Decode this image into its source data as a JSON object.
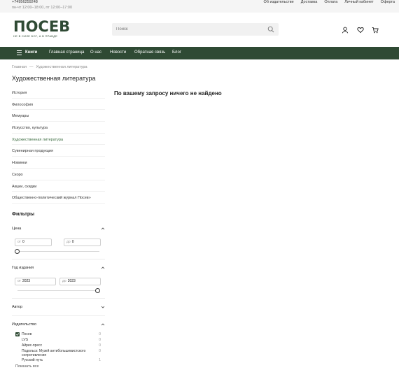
{
  "topbar": {
    "phone": "+74956259248",
    "hours": "пн-чт 12:00–18:00, пт 12:00–17:00",
    "links": [
      "Об издательстве",
      "Доставка",
      "Оплата",
      "Личный кабинет",
      "Оферта"
    ]
  },
  "header": {
    "logo_word": "ПОСЕВ",
    "logo_tagline": "НЕ В СИЛЕ БОГ, А В ПРАВДЕ",
    "search_placeholder": "Поиск",
    "icons": [
      "user-icon",
      "heart-icon",
      "cart-icon"
    ]
  },
  "nav": {
    "catalog": "Книги",
    "items": [
      "Главная страница",
      "О нас",
      "Новости",
      "Обратная связь",
      "Блог"
    ]
  },
  "breadcrumb": [
    "Главная",
    "Художественная литература"
  ],
  "page_title": "Художественная литература",
  "categories": [
    {
      "label": "История",
      "active": false
    },
    {
      "label": "Философия",
      "active": false
    },
    {
      "label": "Мемуары",
      "active": false
    },
    {
      "label": "Искусство, культура",
      "active": false
    },
    {
      "label": "Художественная литература",
      "active": true
    },
    {
      "label": "Сувенирная продукция",
      "active": false
    },
    {
      "label": "Новинки",
      "active": false
    },
    {
      "label": "Скоро",
      "active": false
    },
    {
      "label": "Акции, скидки",
      "active": false
    },
    {
      "label": "Общественно-политический журнал Посев»",
      "active": false
    }
  ],
  "filters": {
    "title": "Фильтры",
    "price": {
      "label": "Цена",
      "from_prefix": "от",
      "from": "0",
      "to_prefix": "до",
      "to": "0"
    },
    "year": {
      "label": "Год издания",
      "from_prefix": "от",
      "from": "2023",
      "to_prefix": "до",
      "to": "2023"
    },
    "author": {
      "label": "Автор"
    },
    "publisher": {
      "label": "Издательство",
      "items": [
        {
          "label": "Посев",
          "count": "0",
          "checked": true
        },
        {
          "label": "LVS",
          "count": "0",
          "checked": false
        },
        {
          "label": "Айрис-пресс",
          "count": "0",
          "checked": false
        },
        {
          "label": "Подольск: Музей антибольшевистского сопротивления",
          "count": "0",
          "checked": false
        },
        {
          "label": "Русский путь",
          "count": "1",
          "checked": false
        }
      ],
      "show_all": "Показать все"
    }
  },
  "main": {
    "not_found": "По вашему запросу ничего не найдено"
  },
  "colors": {
    "brand_green": "#2f4a34",
    "active_link": "#3a6b3f"
  }
}
